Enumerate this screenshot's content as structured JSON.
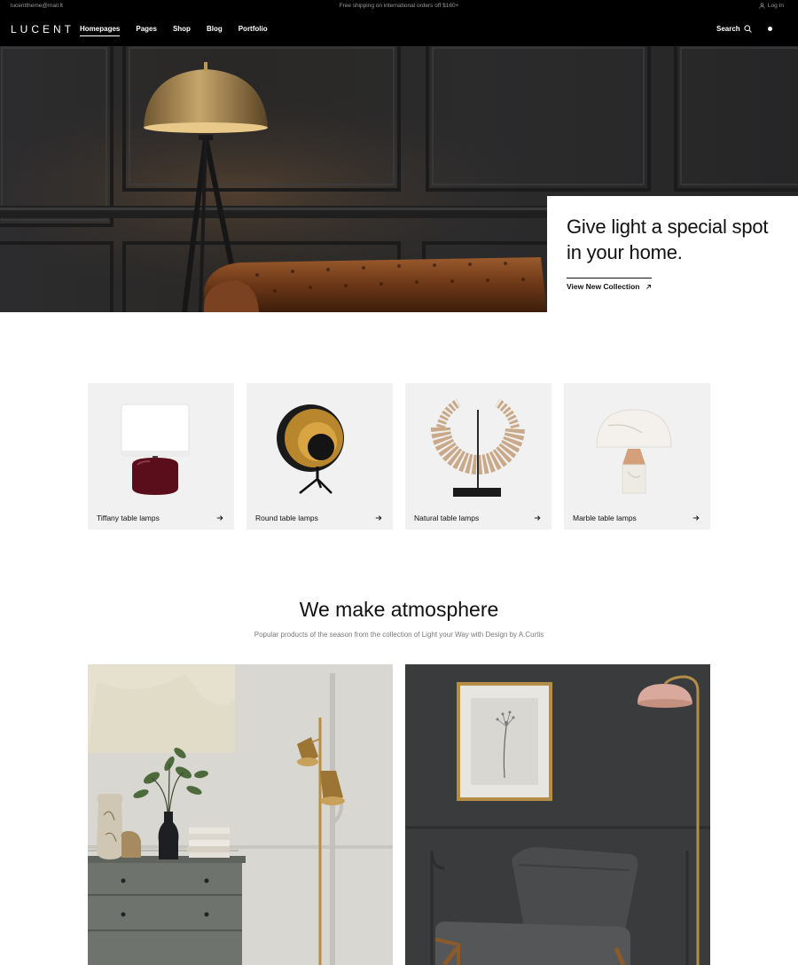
{
  "topbar": {
    "email": "lucenttheme@mail.lt",
    "shipping": "Free shipping on international orders off $160+",
    "login_label": "Log In",
    "login_icon": "user-icon"
  },
  "nav": {
    "logo": "LUCENT",
    "items": [
      {
        "label": "Homepages",
        "active": true
      },
      {
        "label": "Pages",
        "active": false
      },
      {
        "label": "Shop",
        "active": false
      },
      {
        "label": "Blog",
        "active": false
      },
      {
        "label": "Portfolio",
        "active": false
      }
    ],
    "search_label": "Search",
    "search_icon": "search-icon"
  },
  "hero": {
    "title_line1": "Give light a special spot",
    "title_line2": "in your home.",
    "cta_label": "View New Collection",
    "cta_icon": "arrow-up-right-icon"
  },
  "categories": [
    {
      "label": "Tiffany table lamps",
      "icon": "arrow-right-icon"
    },
    {
      "label": "Round table lamps",
      "icon": "arrow-right-icon"
    },
    {
      "label": "Natural table lamps",
      "icon": "arrow-right-icon"
    },
    {
      "label": "Marble table lamps",
      "icon": "arrow-right-icon"
    }
  ],
  "section": {
    "title": "We make atmosphere",
    "subtitle": "Popular products of the season from the collection of Light your Way with Design by A.Curtis"
  },
  "colors": {
    "black": "#000000",
    "card_bg": "#f1f1f1",
    "text": "#111111",
    "muted": "#7a7a7a"
  }
}
